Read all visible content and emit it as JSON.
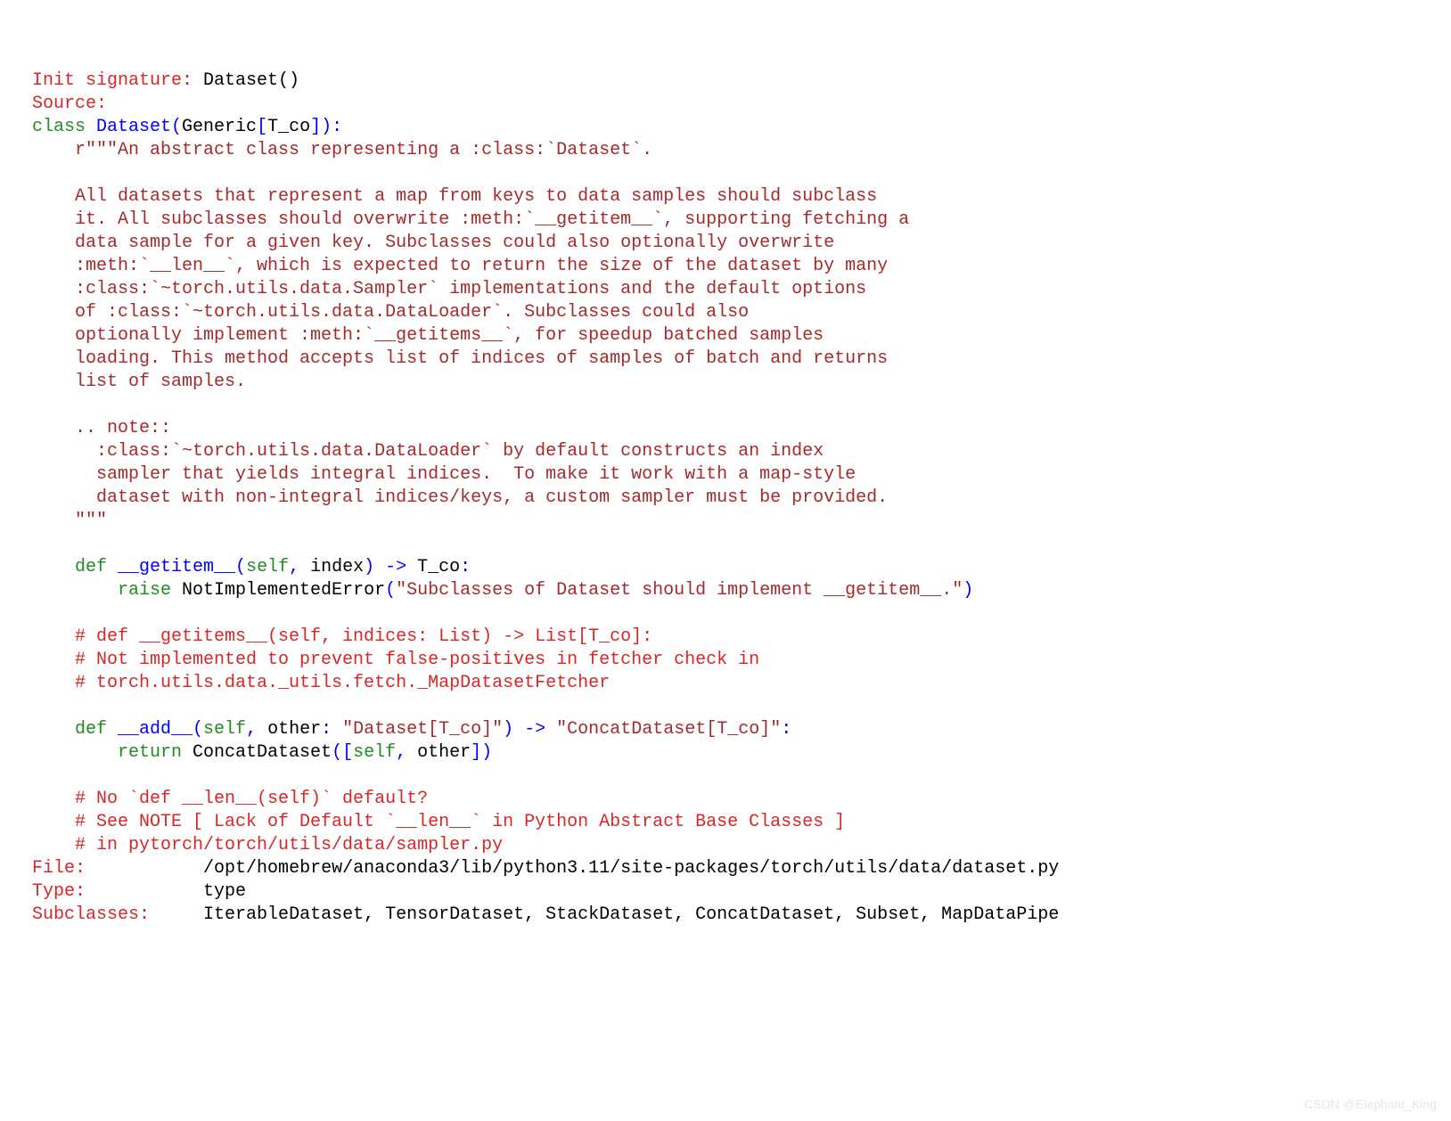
{
  "header": {
    "init_sig_label": "Init signature:",
    "init_sig_value": " Dataset()",
    "source_label": "Source:"
  },
  "code": {
    "class_kw": "class",
    "class_name": " Dataset",
    "paren_open": "(",
    "generic": "Generic",
    "bracket_open": "[",
    "tco": "T_co",
    "bracket_close": "]",
    "paren_close": ")",
    "colon": ":",
    "doc_open": "    r\"\"\"An abstract class representing a :class:`Dataset`.",
    "doc_blank1": "",
    "doc_l1": "    All datasets that represent a map from keys to data samples should subclass",
    "doc_l2": "    it. All subclasses should overwrite :meth:`__getitem__`, supporting fetching a",
    "doc_l3": "    data sample for a given key. Subclasses could also optionally overwrite",
    "doc_l4": "    :meth:`__len__`, which is expected to return the size of the dataset by many",
    "doc_l5": "    :class:`~torch.utils.data.Sampler` implementations and the default options",
    "doc_l6": "    of :class:`~torch.utils.data.DataLoader`. Subclasses could also",
    "doc_l7": "    optionally implement :meth:`__getitems__`, for speedup batched samples",
    "doc_l8": "    loading. This method accepts list of indices of samples of batch and returns",
    "doc_l9": "    list of samples.",
    "doc_blank2": "",
    "doc_note": "    .. note::",
    "doc_n1": "      :class:`~torch.utils.data.DataLoader` by default constructs an index",
    "doc_n2": "      sampler that yields integral indices.  To make it work with a map-style",
    "doc_n3": "      dataset with non-integral indices/keys, a custom sampler must be provided.",
    "doc_close": "    \"\"\"",
    "blank3": "",
    "def1_kw": "    def",
    "def1_name": " __getitem__",
    "def1_args_open": "(",
    "def1_self": "self",
    "def1_comma": ",",
    "def1_index": " index",
    "def1_close": ")",
    "def1_arrow": " ->",
    "def1_ret": " T_co",
    "def1_colon": ":",
    "raise_kw": "        raise",
    "raise_err": " NotImplementedError",
    "raise_open": "(",
    "raise_msg": "\"Subclasses of Dataset should implement __getitem__.\"",
    "raise_close": ")",
    "blank4": "",
    "cmt1": "    # def __getitems__(self, indices: List) -> List[T_co]:",
    "cmt2": "    # Not implemented to prevent false-positives in fetcher check in",
    "cmt3": "    # torch.utils.data._utils.fetch._MapDatasetFetcher",
    "blank5": "",
    "def2_kw": "    def",
    "def2_name": " __add__",
    "def2_open": "(",
    "def2_self": "self",
    "def2_comma1": ",",
    "def2_other": " other",
    "def2_colon1": ":",
    "def2_type": " \"Dataset[T_co]\"",
    "def2_close": ")",
    "def2_arrow": " ->",
    "def2_ret": " \"ConcatDataset[T_co]\"",
    "def2_colon2": ":",
    "ret_kw": "        return",
    "ret_cls": " ConcatDataset",
    "ret_open": "(",
    "ret_bracket_open": "[",
    "ret_self": "self",
    "ret_comma": ",",
    "ret_other": " other",
    "ret_bracket_close": "]",
    "ret_close": ")",
    "blank6": "",
    "cmt4": "    # No `def __len__(self)` default?",
    "cmt5": "    # See NOTE [ Lack of Default `__len__` in Python Abstract Base Classes ]",
    "cmt6": "    # in pytorch/torch/utils/data/sampler.py"
  },
  "footer": {
    "file_label": "File:",
    "file_pad": "           ",
    "file_value": "/opt/homebrew/anaconda3/lib/python3.11/site-packages/torch/utils/data/dataset.py",
    "type_label": "Type:",
    "type_pad": "           ",
    "type_value": "type",
    "sub_label": "Subclasses:",
    "sub_pad": "     ",
    "sub_value": "IterableDataset, TensorDataset, StackDataset, ConcatDataset, Subset, MapDataPipe"
  },
  "watermark": "CSDN @Elephant_King"
}
